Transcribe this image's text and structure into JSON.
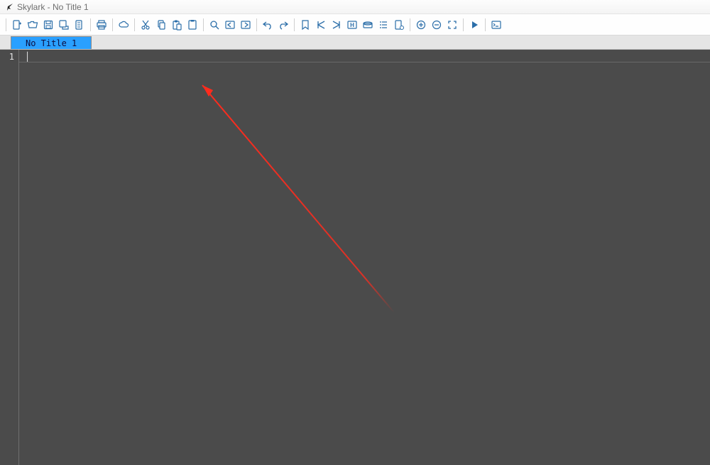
{
  "title": "Skylark - No Title 1",
  "tab": {
    "label": "No Title 1"
  },
  "editor": {
    "line1_no": "1",
    "line1_text": ""
  },
  "colors": {
    "accent": "#2aa0ff",
    "editor_bg": "#4b4b4b",
    "icon": "#2b6ea9",
    "arrow": "#ff2b1d"
  },
  "toolbar_icons": [
    "new-file",
    "open-file",
    "save",
    "save-as",
    "new-document",
    "sep",
    "print",
    "sep",
    "cloud",
    "sep",
    "cut",
    "copy",
    "paste",
    "clipboard",
    "sep",
    "search",
    "find-prev",
    "find-next",
    "sep",
    "undo",
    "redo",
    "sep",
    "bookmark",
    "bookmark-prev",
    "bookmark-next",
    "bookmark-toggle",
    "disk",
    "list",
    "file-settings",
    "sep",
    "zoom-in",
    "zoom-out",
    "fullscreen",
    "sep",
    "run",
    "sep",
    "terminal"
  ]
}
